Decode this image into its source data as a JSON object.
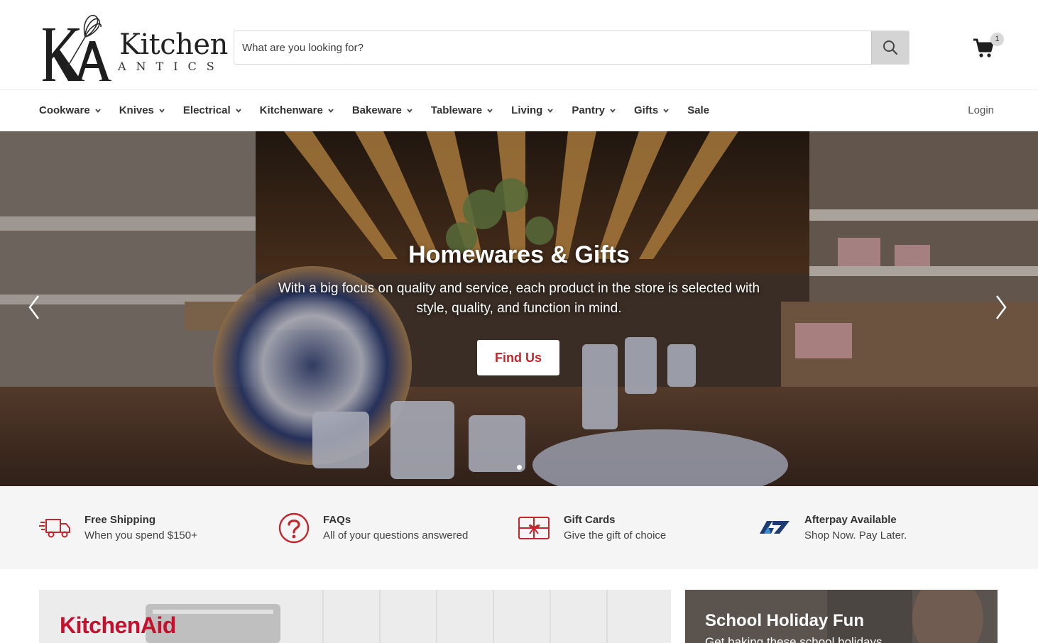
{
  "brand": {
    "logo_word": "Kitchen",
    "logo_sub": "ANTICS",
    "accent_color": "#c1272d"
  },
  "search": {
    "placeholder": "What are you looking for?",
    "value": ""
  },
  "cart": {
    "count": "1"
  },
  "nav": {
    "items": [
      {
        "label": "Cookware",
        "has_dropdown": true
      },
      {
        "label": "Knives",
        "has_dropdown": true
      },
      {
        "label": "Electrical",
        "has_dropdown": true
      },
      {
        "label": "Kitchenware",
        "has_dropdown": true
      },
      {
        "label": "Bakeware",
        "has_dropdown": true
      },
      {
        "label": "Tableware",
        "has_dropdown": true
      },
      {
        "label": "Living",
        "has_dropdown": true
      },
      {
        "label": "Pantry",
        "has_dropdown": true
      },
      {
        "label": "Gifts",
        "has_dropdown": true
      },
      {
        "label": "Sale",
        "has_dropdown": false
      }
    ],
    "login_label": "Login"
  },
  "hero": {
    "title": "Homewares & Gifts",
    "text": "With a big focus on quality and service, each product in the store is selected with style, quality, and function in mind.",
    "button_label": "Find Us",
    "slide_count": 1,
    "active_slide": 0
  },
  "features": [
    {
      "icon": "truck-icon",
      "title": "Free Shipping",
      "subtitle": "When you spend $150+"
    },
    {
      "icon": "question-icon",
      "title": "FAQs",
      "subtitle": "All of your questions answered"
    },
    {
      "icon": "gift-card-icon",
      "title": "Gift Cards",
      "subtitle": "Give the gift of choice"
    },
    {
      "icon": "afterpay-icon",
      "title": "Afterpay Available",
      "subtitle": "Shop Now. Pay Later."
    }
  ],
  "promos": {
    "left_title": "KitchenAid",
    "right_title": "School Holiday Fun",
    "right_subtitle": "Get baking these school holidays"
  }
}
